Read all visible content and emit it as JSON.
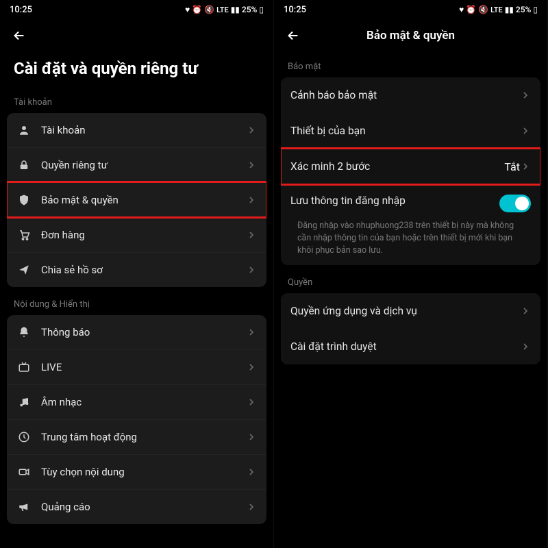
{
  "status": {
    "time": "10:25",
    "battery": "25%"
  },
  "left": {
    "title": "Cài đặt và quyền riêng tư",
    "section1_label": "Tài khoản",
    "section1_items": [
      {
        "label": "Tài khoản"
      },
      {
        "label": "Quyền riêng tư"
      },
      {
        "label": "Bảo mật & quyền"
      },
      {
        "label": "Đơn hàng"
      },
      {
        "label": "Chia sẻ hồ sơ"
      }
    ],
    "section2_label": "Nội dung & Hiển thị",
    "section2_items": [
      {
        "label": "Thông báo"
      },
      {
        "label": "LIVE"
      },
      {
        "label": "Âm nhạc"
      },
      {
        "label": "Trung tâm hoạt động"
      },
      {
        "label": "Tùy chọn nội dung"
      },
      {
        "label": "Quảng cáo"
      }
    ]
  },
  "right": {
    "header": "Bảo mật & quyền",
    "section1_label": "Bảo mật",
    "items1": [
      {
        "label": "Cảnh báo bảo mật"
      },
      {
        "label": "Thiết bị của bạn"
      },
      {
        "label": "Xác minh 2 bước",
        "value": "Tắt"
      }
    ],
    "save_login_label": "Lưu thông tin đăng nhập",
    "save_login_desc": "Đăng nhập vào nhuphuong238 trên thiết bị này mà không cần nhập thông tin của bạn hoặc trên thiết bị mới khi bạn khôi phục bản sao lưu.",
    "section2_label": "Quyền",
    "items2": [
      {
        "label": "Quyền ứng dụng và dịch vụ"
      },
      {
        "label": "Cài đặt trình duyệt"
      }
    ]
  }
}
